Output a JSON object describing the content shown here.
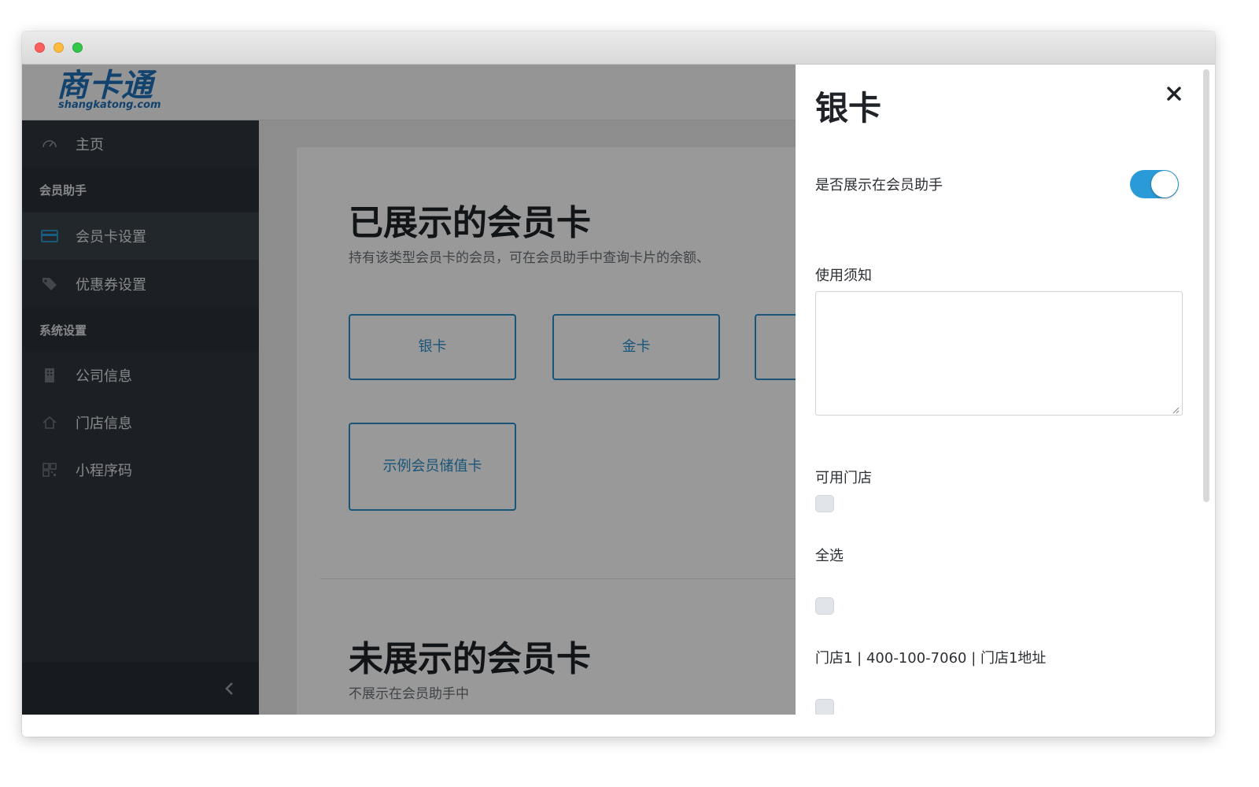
{
  "window": {
    "controls": [
      "close",
      "minimize",
      "maximize"
    ]
  },
  "header": {
    "logo_main": "商卡通",
    "logo_sub": "shangkatong.com"
  },
  "sidebar": {
    "items": [
      {
        "label": "主页",
        "icon": "dashboard-icon"
      },
      {
        "label": "会员助手",
        "type": "section"
      },
      {
        "label": "会员卡设置",
        "icon": "credit-card-icon",
        "active": true
      },
      {
        "label": "优惠券设置",
        "icon": "tag-icon"
      },
      {
        "label": "系统设置",
        "type": "section"
      },
      {
        "label": "公司信息",
        "icon": "building-icon"
      },
      {
        "label": "门店信息",
        "icon": "home-icon"
      },
      {
        "label": "小程序码",
        "icon": "qrcode-icon"
      }
    ],
    "collapse_icon": "chevron-left-icon"
  },
  "main": {
    "shown_title": "已展示的会员卡",
    "shown_desc": "持有该类型会员卡的会员，可在会员助手中查询卡片的余额、",
    "cards": [
      "银卡",
      "金卡",
      "",
      "示例会员储值卡"
    ],
    "hidden_title": "未展示的会员卡",
    "hidden_desc": "不展示在会员助手中"
  },
  "panel": {
    "title": "银卡",
    "close_icon": "close-icon",
    "show_in_assistant_label": "是否展示在会员助手",
    "show_in_assistant": true,
    "usage_notes_label": "使用须知",
    "usage_notes_value": "",
    "stores_label": "可用门店",
    "select_all_label": "全选",
    "store_1": "门店1 | 400-100-7060 | 门店1地址"
  },
  "colors": {
    "accent": "#2b9bd7",
    "card_border": "#2b8ec9",
    "sidebar_bg": "#2f353d",
    "logo": "#1f6fb8"
  }
}
